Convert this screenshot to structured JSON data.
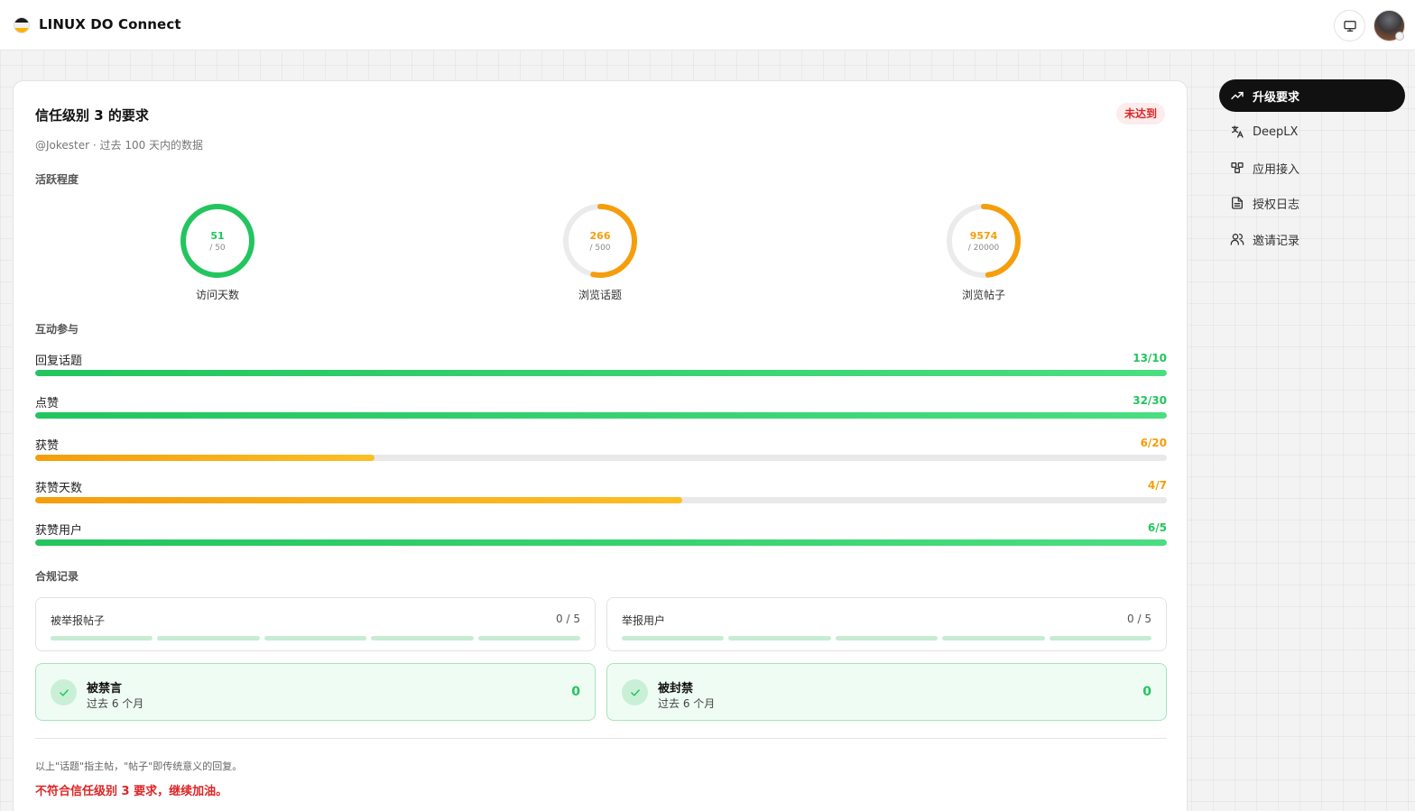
{
  "app": {
    "title": "LINUX DO Connect"
  },
  "card": {
    "title": "信任级别 3 的要求",
    "status_badge": "未达到",
    "subtitle": "@Jokester · 过去 100 天内的数据"
  },
  "activity": {
    "section_label": "活跃程度",
    "rings": [
      {
        "value": "51",
        "target": "/ 50",
        "label": "访问天数",
        "progress": 1.0,
        "color": "#22c55e"
      },
      {
        "value": "266",
        "target": "/ 500",
        "label": "浏览话题",
        "progress": 0.532,
        "color": "#f59e0b"
      },
      {
        "value": "9574",
        "target": "/ 20000",
        "label": "浏览帖子",
        "progress": 0.4787,
        "color": "#f59e0b"
      }
    ]
  },
  "interaction": {
    "section_label": "互动参与",
    "bars": [
      {
        "label": "回复话题",
        "value": "13/10",
        "progress": 1.0,
        "state": "green"
      },
      {
        "label": "点赞",
        "value": "32/30",
        "progress": 1.0,
        "state": "green"
      },
      {
        "label": "获赞",
        "value": "6/20",
        "progress": 0.3,
        "state": "orange"
      },
      {
        "label": "获赞天数",
        "value": "4/7",
        "progress": 0.5714,
        "state": "orange"
      },
      {
        "label": "获赞用户",
        "value": "6/5",
        "progress": 1.0,
        "state": "green"
      }
    ]
  },
  "compliance": {
    "section_label": "合规记录",
    "reports": [
      {
        "label": "被举报帖子",
        "value": "0 / 5"
      },
      {
        "label": "举报用户",
        "value": "0 / 5"
      }
    ],
    "bans": [
      {
        "title": "被禁言",
        "subtitle": "过去 6 个月",
        "value": "0"
      },
      {
        "title": "被封禁",
        "subtitle": "过去 6 个月",
        "value": "0"
      }
    ]
  },
  "footer": {
    "note": "以上\"话题\"指主帖，\"帖子\"即传统意义的回复。",
    "status": "不符合信任级别 3 要求，继续加油。"
  },
  "sidebar": {
    "items": [
      {
        "label": "升级要求",
        "icon": "trending-up-icon",
        "active": true
      },
      {
        "label": "DeepLX",
        "icon": "translate-icon",
        "active": false
      },
      {
        "label": "应用接入",
        "icon": "apps-icon",
        "active": false
      },
      {
        "label": "授权日志",
        "icon": "document-icon",
        "active": false
      },
      {
        "label": "邀请记录",
        "icon": "users-icon",
        "active": false
      }
    ]
  },
  "colors": {
    "success": "#22c55e",
    "warning": "#f59e0b",
    "danger": "#dc2626"
  }
}
